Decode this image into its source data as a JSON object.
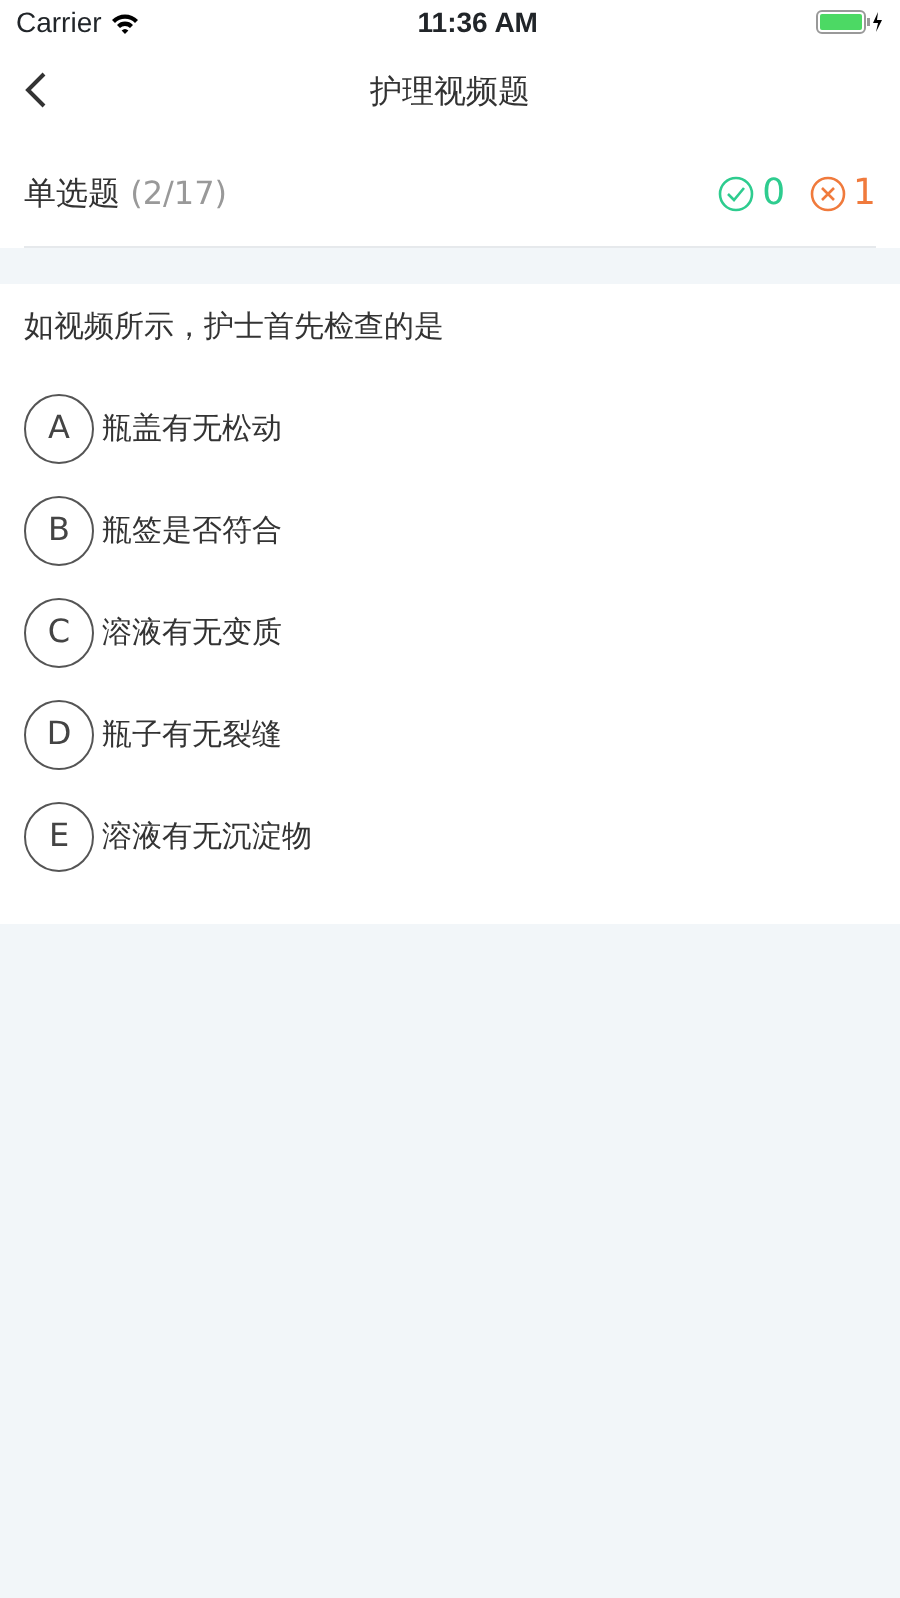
{
  "status_bar": {
    "carrier": "Carrier",
    "time": "11:36 AM"
  },
  "nav": {
    "title": "护理视频题"
  },
  "header": {
    "type_label": "单选题",
    "progress": "(2/17)",
    "correct_count": "0",
    "wrong_count": "1"
  },
  "question": {
    "text": "如视频所示，护士首先检查的是",
    "options": [
      {
        "letter": "A",
        "text": "瓶盖有无松动",
        "selected": false
      },
      {
        "letter": "B",
        "text": "瓶签是否符合",
        "selected": false
      },
      {
        "letter": "C",
        "text": "溶液有无变质",
        "selected": false
      },
      {
        "letter": "D",
        "text": "瓶子有无裂缝",
        "selected": false
      },
      {
        "letter": "E",
        "text": "溶液有无沉淀物",
        "selected": false
      }
    ]
  }
}
